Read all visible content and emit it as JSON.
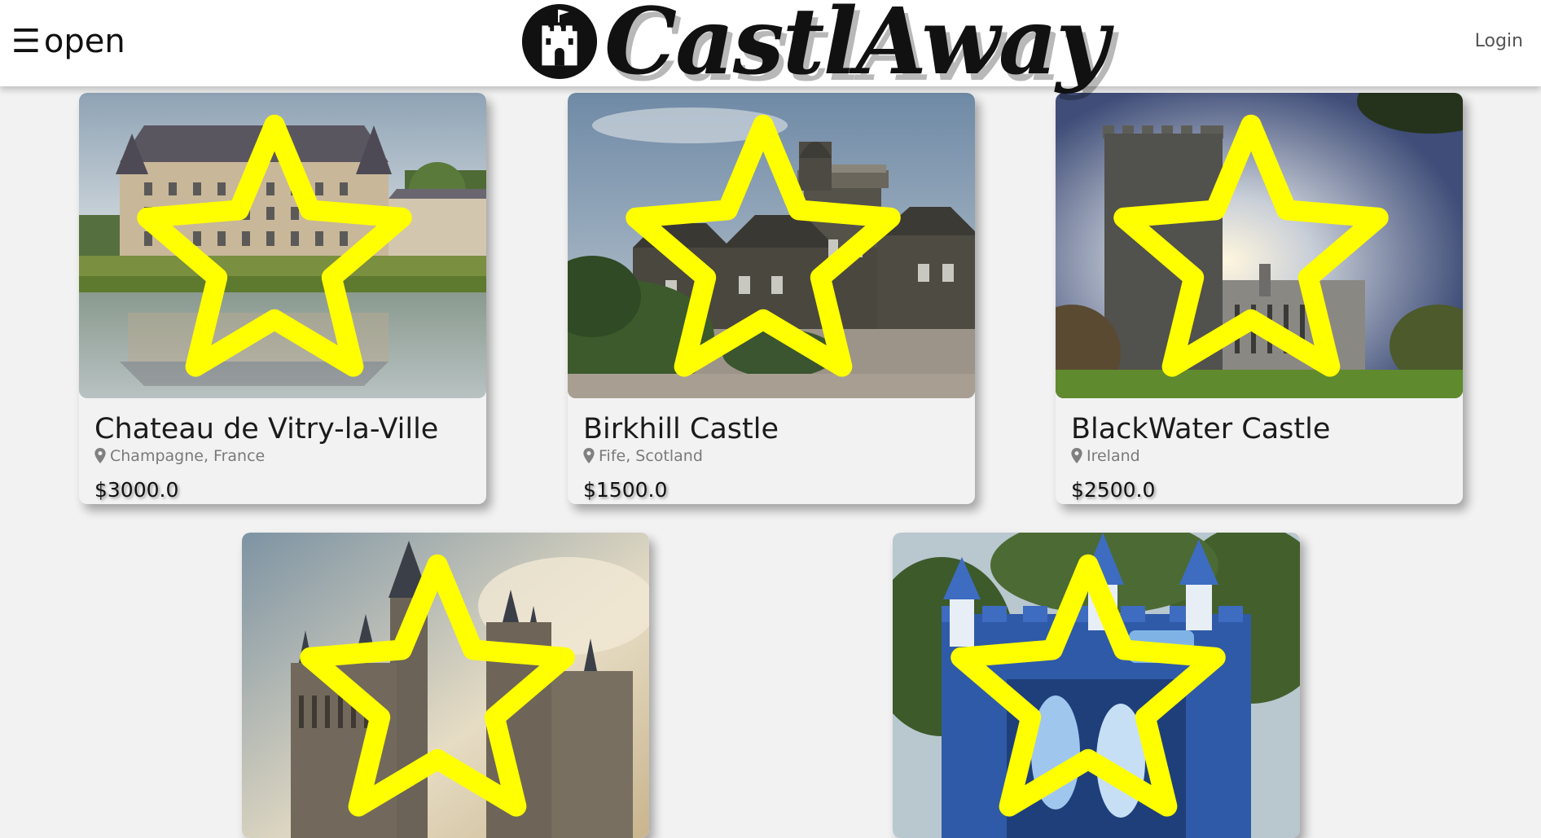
{
  "header": {
    "menu_glyph": "☰",
    "menu_label": "open",
    "brand": "CastlAway",
    "login_label": "Login"
  },
  "colors": {
    "favorite_star": "#ffff00",
    "header_bg": "#ffffff",
    "page_bg": "#f2f2f2"
  },
  "listings": [
    {
      "title": "Chateau de Vitry-la-Ville",
      "location": "Champagne, France",
      "price": "$3000.0",
      "favorited": false
    },
    {
      "title": "Birkhill Castle",
      "location": "Fife, Scotland",
      "price": "$1500.0",
      "favorited": false
    },
    {
      "title": "BlackWater Castle",
      "location": "Ireland",
      "price": "$2500.0",
      "favorited": false
    },
    {
      "title": "",
      "location": "",
      "price": "",
      "favorited": false
    },
    {
      "title": "",
      "location": "",
      "price": "",
      "favorited": false
    }
  ]
}
